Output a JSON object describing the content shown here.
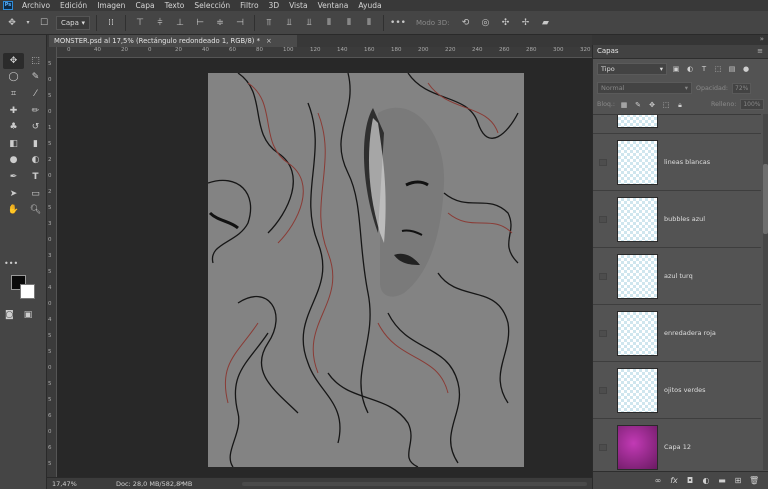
{
  "menu": {
    "logo": "Ps",
    "items": [
      "Archivo",
      "Edición",
      "Imagen",
      "Capa",
      "Texto",
      "Selección",
      "Filtro",
      "3D",
      "Vista",
      "Ventana",
      "Ayuda"
    ]
  },
  "options": {
    "layer_select": "Capa",
    "mode_3d": "Modo 3D:"
  },
  "document": {
    "tab_title": "MONSTER.psd al 17,5% (Rectángulo redondeado 1, RGB/8) *",
    "close": "×"
  },
  "ruler": {
    "top": [
      "0",
      "40",
      "20",
      "0",
      "20",
      "40",
      "60",
      "80",
      "100",
      "120",
      "140",
      "160",
      "180",
      "200",
      "220",
      "240",
      "260",
      "280",
      "300",
      "320"
    ],
    "left": [
      "5",
      "0",
      "5",
      "0",
      "1",
      "5",
      "2",
      "0",
      "2",
      "5",
      "3",
      "0",
      "3",
      "5",
      "4",
      "0",
      "4",
      "5",
      "5",
      "0",
      "5",
      "5",
      "6",
      "0",
      "6",
      "5"
    ]
  },
  "status": {
    "zoom": "17,47%",
    "doc_size": "Doc: 28,0 MB/582,8 MB",
    "arrow": ">"
  },
  "panel": {
    "title": "Capas",
    "filter_label": "Tipo",
    "blend_mode": "Normal",
    "opacity_label": "Opacidad:",
    "opacity_value": "72%",
    "lock_label": "Bloq.:",
    "fill_label": "Relleno:",
    "fill_value": "100%",
    "layers": [
      {
        "name": ""
      },
      {
        "name": "lineas blancas"
      },
      {
        "name": "bubbles azul"
      },
      {
        "name": "azul turq"
      },
      {
        "name": "enredadera roja"
      },
      {
        "name": "ojitos verdes"
      },
      {
        "name": "Capa 12"
      }
    ]
  },
  "colors": {
    "accent": "#2e8bd9",
    "foreground": "#0a0a0a",
    "background": "#ffffff",
    "layer12_thumb": "#9b1f8f"
  }
}
